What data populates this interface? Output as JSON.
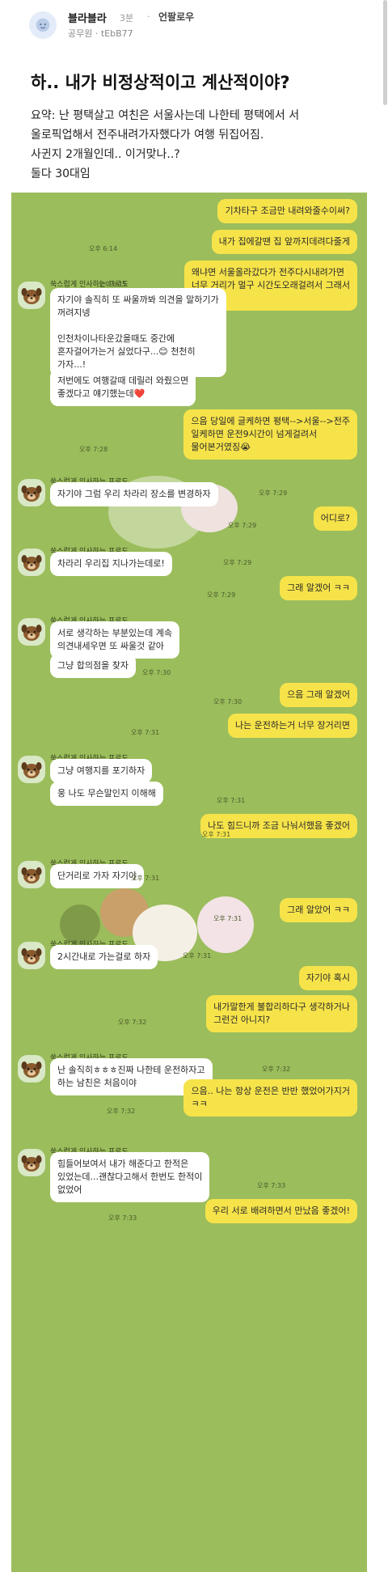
{
  "post": {
    "poster_name": "블라블라",
    "time": "3분",
    "separator": "·",
    "company": "언팔로우",
    "job": "공무원 · tEbB77",
    "title": "하.. 내가 비정상적이고 계산적이야?",
    "body_lines": [
      "요약: 난 평택살고 여친은 서울사는데 나한테 평택에서 서",
      "울로픽업해서 전주내려가자했다가 여행 뒤집어짐.",
      "사귄지 2개월인데.. 이거맞나..?",
      "둘다 30대임"
    ]
  },
  "chat": {
    "partner_name": "쑥스럽게 인사하는 프로도",
    "messages": [
      {
        "from": "me",
        "lines": [
          "기차타구 조금만 내려와줄수이써?"
        ]
      },
      {
        "from": "me",
        "lines": [
          "내가 집에갈땐 집 앞까지데려다줄게"
        ],
        "time": "오후 6:14"
      },
      {
        "from": "me",
        "lines": [
          "왜냐면 서울올라갔다가 전주다시내려가면",
          "너무 거리가 멀구 시간도오래걸려서 그래서",
          "😮"
        ],
        "time": "오후 6:15"
      },
      {
        "from": "other",
        "lines": [
          "자기야 솔직히 또 싸울까봐 의견을 말하기가",
          "꺼려지넹",
          "",
          "인천차이나타운갔을때도 중간에",
          "혼자걸어가는거 싫었다구...😊 천천히",
          "가자...!"
        ]
      },
      {
        "from": "other",
        "lines": [
          "저번에도 여행갈때 데릴러 와줬으면",
          "좋겠다고 얘기했는데❤️"
        ],
        "time": "오후 7:27"
      },
      {
        "from": "me",
        "lines": [
          "으음 당일에 글케하면 평택-->서울-->전주",
          "일케하면 운전9시간이 넘게걸려서",
          "물어본거였징😭"
        ],
        "time": "오후 7:28"
      },
      {
        "from": "other",
        "lines": [
          "자기야 그럼 우리 차라리 장소를 변경하자"
        ],
        "time": "오후 7:29"
      },
      {
        "from": "me",
        "lines": [
          "어디로?"
        ],
        "time": "오후 7:29"
      },
      {
        "from": "other",
        "lines": [
          "차라리 우리집 지나가는데로!"
        ],
        "time": "오후 7:29"
      },
      {
        "from": "me",
        "lines": [
          "그래 알겠어 ㅋㅋ"
        ],
        "time": "오후 7:29"
      },
      {
        "from": "other",
        "lines": [
          "서로 생각하는 부분있는데 계속",
          "의견내세우면 또 싸울것 같아"
        ]
      },
      {
        "from": "other",
        "lines": [
          "그냥 합의점을 찾자"
        ],
        "time": "오후 7:30"
      },
      {
        "from": "me",
        "lines": [
          "으음 그래 알겠어"
        ],
        "time": "오후 7:30"
      },
      {
        "from": "me",
        "lines": [
          "나는 운전하는거 너무 장거리면"
        ],
        "time": "오후 7:31"
      },
      {
        "from": "other",
        "lines": [
          "그냥 여행지를 포기하자"
        ]
      },
      {
        "from": "other",
        "lines": [
          "웅 나도 무슨말인지 이해해"
        ],
        "time": "오후 7:31"
      },
      {
        "from": "me",
        "lines": [
          "나도 힘드니까 조금 나눠서했음 좋겠어"
        ],
        "time": "오후 7:31"
      },
      {
        "from": "other",
        "lines": [
          "단거리로 가자 자기야"
        ],
        "time": "오후 7:31"
      },
      {
        "from": "me",
        "lines": [
          "그래 알았어 ㅋㅋ"
        ],
        "time": "오후 7:31"
      },
      {
        "from": "other",
        "lines": [
          "2시간내로 가는걸로 하자"
        ],
        "time": "오후 7:31"
      },
      {
        "from": "me",
        "lines": [
          "자기야 혹시"
        ]
      },
      {
        "from": "me",
        "lines": [
          "내가말한게 불합리하다구 생각하거나",
          "그런건 아니지?"
        ],
        "time": "오후 7:32"
      },
      {
        "from": "other",
        "lines": [
          "난 솔직히ㅎㅎㅎ진짜 나한테 운전하자고",
          "하는 남친은 처음이야"
        ],
        "time": "오후 7:32"
      },
      {
        "from": "me",
        "lines": [
          "으음.. 나는 항상 운전은 반반 했었어가지거",
          "ㅋㅋ"
        ],
        "time": "오후 7:32"
      },
      {
        "from": "other",
        "lines": [
          "힘들어보여서 내가 해준다고 한적은",
          "있었는데...괜찮다고해서 한번도 한적이",
          "없었어"
        ],
        "time": "오후 7:33"
      },
      {
        "from": "me",
        "lines": [
          "우리 서로 배려하면서 만났음 좋겠어!"
        ],
        "time": "오후 7:33"
      }
    ]
  },
  "colors": {
    "chat_background": "#9bbd5c",
    "my_bubble": "#f6e34a",
    "other_bubble": "#ffffff"
  },
  "icons": {
    "avatar_top": "anonymous-user-icon",
    "partner_avatar": "dog-character-icon"
  }
}
